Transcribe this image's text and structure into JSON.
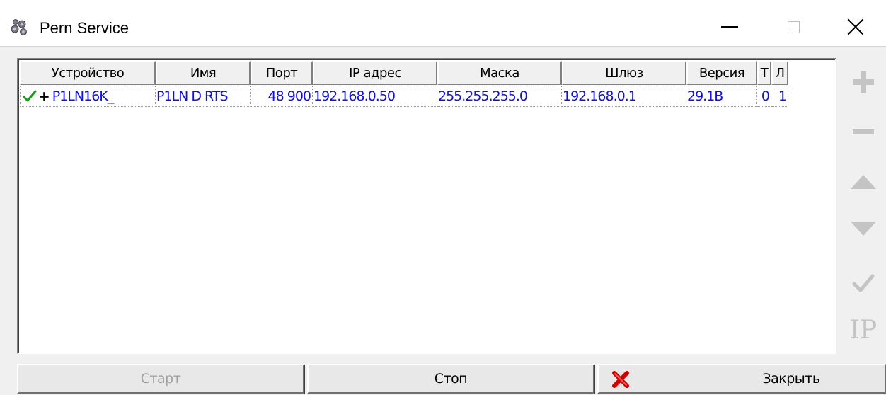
{
  "window": {
    "title": "Pern Service",
    "icon": "flowers-app-icon",
    "controls": [
      "minimize-icon",
      "maximize-icon",
      "close-icon"
    ]
  },
  "grid": {
    "columns": [
      "Устройство",
      "Имя",
      "Порт",
      "IP адрес",
      "Маска",
      "Шлюз",
      "Версия",
      "Т",
      "Л"
    ],
    "rows": [
      {
        "status_icon": "check-icon",
        "expand_mark": "+",
        "device": "P1LN16K_",
        "name": "P1LN D RTS",
        "port": "48 900",
        "ip": "192.168.0.50",
        "mask": "255.255.255.0",
        "gateway": "192.168.0.1",
        "version": "29.1B",
        "t": "0",
        "l": "1"
      }
    ]
  },
  "side_toolbar": {
    "icons": [
      "plus-icon",
      "minus-icon",
      "arrow-up-icon",
      "arrow-down-icon",
      "checkmark-icon",
      "ip-icon"
    ],
    "ip_label": "IP"
  },
  "buttons": {
    "start": "Старт",
    "stop": "Стоп",
    "close": "Закрыть"
  },
  "colors": {
    "data_text": "#1010e0",
    "disabled_icon": "#c4c4c4",
    "check_green": "#1a9a1a",
    "close_red": "#cc0000"
  }
}
